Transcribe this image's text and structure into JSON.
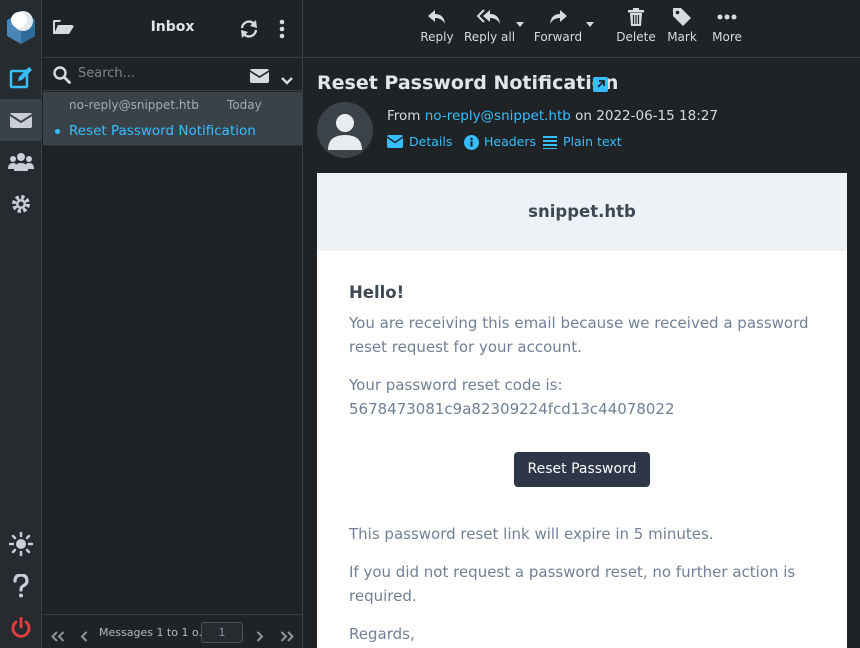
{
  "app": {
    "folder_title": "Inbox",
    "search_placeholder": "Search...",
    "colors": {
      "accent": "#37beff",
      "logout": "#e53e3e",
      "button": "#2d3748"
    }
  },
  "rail": {
    "items": [
      {
        "icon": "compose-icon"
      },
      {
        "icon": "mail-icon",
        "active": true
      },
      {
        "icon": "contacts-icon"
      },
      {
        "icon": "settings-icon"
      },
      {
        "icon": "theme-icon"
      },
      {
        "icon": "help-icon"
      },
      {
        "icon": "logout-icon"
      }
    ]
  },
  "list": {
    "messages": [
      {
        "from": "no-reply@snippet.htb",
        "date": "Today 18:27",
        "subject": "Reset Password Notification",
        "unread": true
      }
    ],
    "footer": {
      "count_text": "Messages 1 to 1 o...",
      "page": "1"
    }
  },
  "toolbar": {
    "reply": "Reply",
    "reply_all": "Reply all",
    "forward": "Forward",
    "delete": "Delete",
    "mark": "Mark",
    "more": "More"
  },
  "message": {
    "subject": "Reset Password Notification",
    "from_label": "From",
    "from_address": "no-reply@snippet.htb",
    "on_text": "on 2022-06-15 18:27",
    "links": {
      "details": "Details",
      "headers": "Headers",
      "plain": "Plain text"
    }
  },
  "email": {
    "brand": "snippet.htb",
    "greeting": "Hello!",
    "para1": "You are receiving this email because we received a password reset request for your account.",
    "para2_line1": "Your password reset code is:",
    "para2_line2": "5678473081c9a82309224fcd13c44078022",
    "button": "Reset Password",
    "para3": "This password reset link will expire in 5 minutes.",
    "para4": "If you did not request a password reset, no further action is required.",
    "regards": "Regards,"
  }
}
